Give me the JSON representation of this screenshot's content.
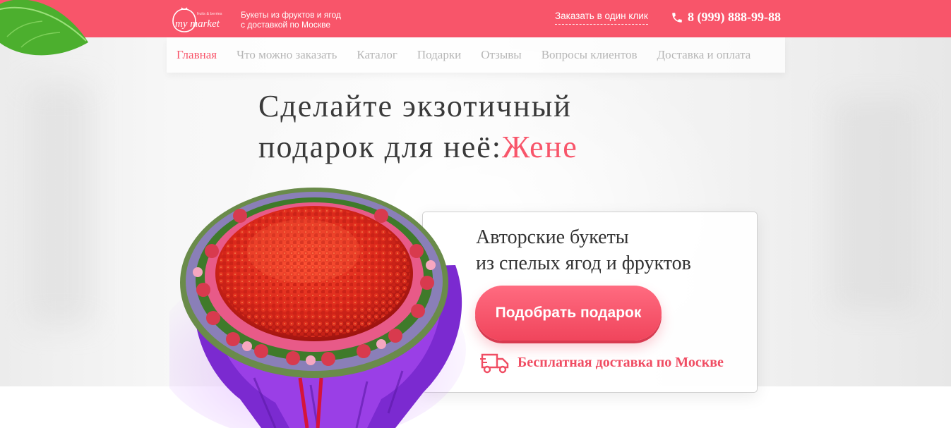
{
  "header": {
    "logo": {
      "small": "fruits & berries",
      "brand": "my market"
    },
    "tagline": [
      "Букеты из фруктов и ягод",
      "с доставкой по Москве"
    ],
    "one_click": "Заказать в один клик",
    "phone": "8 (999) 888-99-88"
  },
  "nav": {
    "items": [
      "Главная",
      "Что можно заказать",
      "Каталог",
      "Подарки",
      "Отзывы",
      "Вопросы клиентов",
      "Доставка и оплата"
    ],
    "active_index": 0
  },
  "hero": {
    "line1": "Сделайте экзотичный",
    "line2": "подарок для неё:",
    "accent": "Жене"
  },
  "card": {
    "title_line1": "Авторские букеты",
    "title_line2": "из спелых ягод и фруктов",
    "button": "Подобрать подарок",
    "delivery": "Бесплатная доставка по Москве"
  },
  "colors": {
    "accent": "#f8556a",
    "text": "#333333",
    "nav_inactive": "#b6b6b6"
  },
  "icons": [
    "leaf-icon",
    "logo-icon",
    "phone-icon",
    "truck-icon"
  ]
}
